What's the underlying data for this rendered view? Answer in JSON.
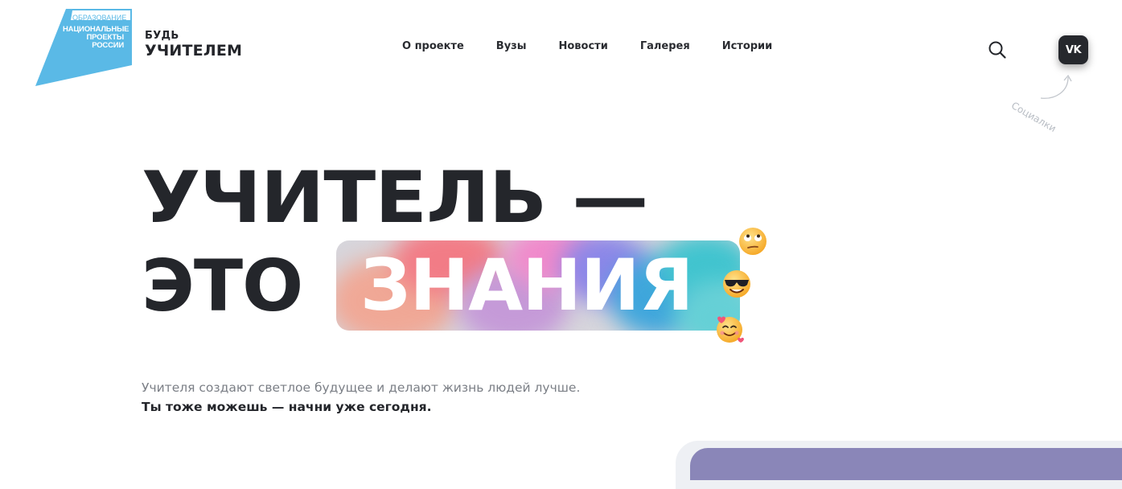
{
  "header": {
    "emblem": {
      "top_text": "ОБРАЗОВАНИЕ",
      "main_text_lines": [
        "НАЦИОНАЛЬНЫЕ",
        "ПРОЕКТЫ",
        "РОССИИ"
      ]
    },
    "brand": {
      "line1": "БУДЬ",
      "line2": "УЧИТЕЛЕМ"
    },
    "nav": [
      {
        "label": "О проекте"
      },
      {
        "label": "Вузы"
      },
      {
        "label": "Новости"
      },
      {
        "label": "Галерея"
      },
      {
        "label": "Истории"
      }
    ],
    "search_icon": "search-icon",
    "social": {
      "vk_label": "VK",
      "hint": "Социалки"
    }
  },
  "hero": {
    "line1": "УЧИТЕЛЬ —",
    "line2_prefix": "ЭТО",
    "highlight_word": "ЗНАНИЯ",
    "emojis": [
      "face-with-rolling-eyes-icon",
      "smiling-face-with-sunglasses-icon",
      "smiling-face-with-hearts-icon"
    ],
    "lead": "Учителя создают светлое будущее и делают жизнь людей лучше.",
    "lead_strong": "Ты тоже можешь — начни уже сегодня."
  },
  "colors": {
    "accent_blue": "#5ab9e6",
    "text_dark": "#24262b",
    "text_muted": "#7b7f86",
    "vk_button": "#26282d"
  }
}
